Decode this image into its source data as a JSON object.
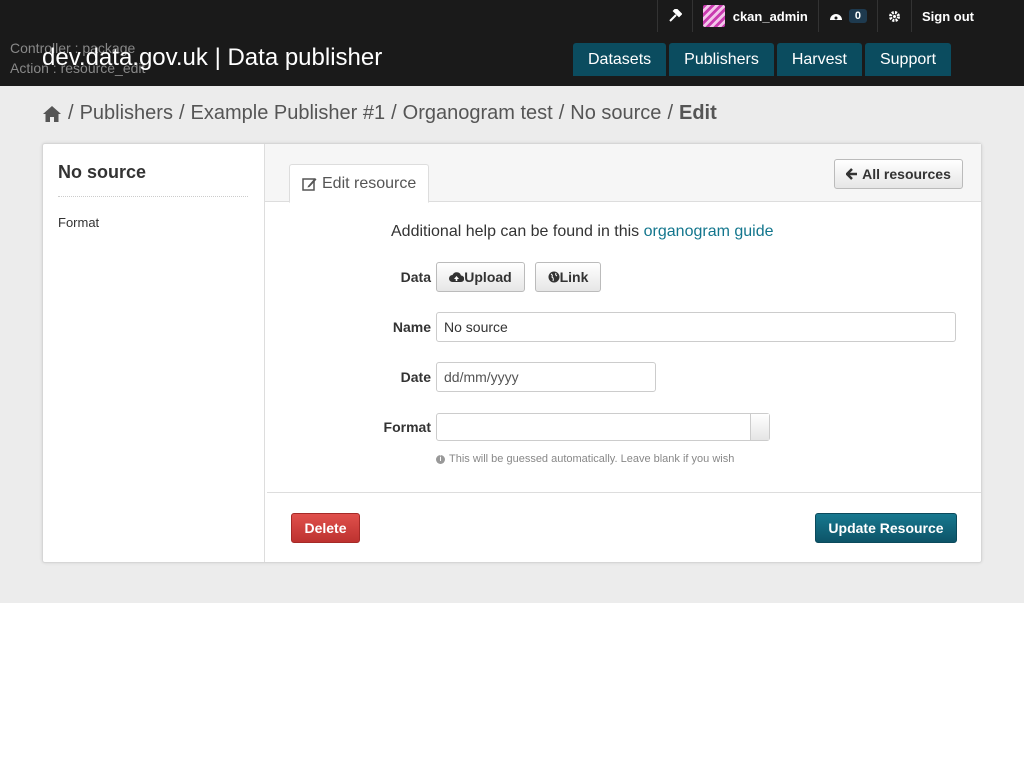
{
  "account": {
    "username": "ckan_admin",
    "dashboard_count": "0",
    "signout": "Sign out"
  },
  "debug": {
    "controller": "Controller : package",
    "action": "Action : resource_edit"
  },
  "site": {
    "domain": "dev.data.gov.uk",
    "separator": "|",
    "subtitle": "Data publisher"
  },
  "nav": [
    "Datasets",
    "Publishers",
    "Harvest",
    "Support"
  ],
  "breadcrumb": {
    "items": [
      "Publishers",
      "Example Publisher #1",
      "Organogram test",
      "No source"
    ],
    "active": "Edit"
  },
  "sidebar": {
    "title": "No source",
    "format_label": "Format"
  },
  "tabs": {
    "edit_resource": "Edit resource",
    "all_resources": "All resources"
  },
  "form": {
    "help_text": "Additional help can be found in this",
    "help_link": "organogram guide",
    "data_label": "Data",
    "upload": "Upload",
    "link": "Link",
    "name_label": "Name",
    "name_value": "No source",
    "date_label": "Date",
    "date_placeholder": "dd/mm/yyyy",
    "format_label": "Format",
    "format_hint": "This will be guessed automatically. Leave blank if you wish",
    "delete": "Delete",
    "update": "Update Resource"
  },
  "colors": {
    "brand_dark": "#0b4c5f",
    "link": "#13768d",
    "danger": "#bd3230"
  }
}
